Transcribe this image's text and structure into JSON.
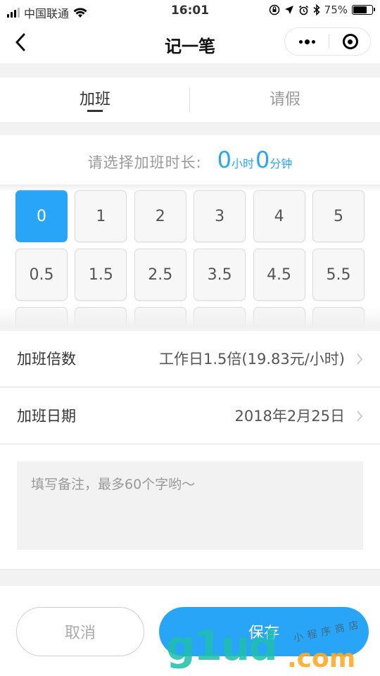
{
  "status_bar": {
    "carrier": "中国联通",
    "time": "16:01",
    "battery_percent": "75%",
    "battery_level": 0.75
  },
  "nav": {
    "title": "记一笔",
    "back_icon": "chevron-left-icon",
    "more_icon": "more-dots-icon",
    "close_icon": "target-circle-icon"
  },
  "tabs": [
    {
      "label": "加班",
      "active": true
    },
    {
      "label": "请假",
      "active": false
    }
  ],
  "duration": {
    "prompt": "请选择加班时长:",
    "hours": "0",
    "hours_unit": "小时",
    "minutes": "0",
    "minutes_unit": "分钟"
  },
  "picker": {
    "options": [
      "0",
      "1",
      "2",
      "3",
      "4",
      "5",
      "0.5",
      "1.5",
      "2.5",
      "3.5",
      "4.5",
      "5.5",
      "",
      "",
      "",
      "",
      "",
      ""
    ],
    "selected": "0"
  },
  "rate_row": {
    "label": "加班倍数",
    "value": "工作日1.5倍(19.83元/小时)"
  },
  "date_row": {
    "label": "加班日期",
    "value": "2018年2月25日"
  },
  "note": {
    "placeholder": "填写备注，最多60个字哟～",
    "value": ""
  },
  "buttons": {
    "cancel": "取消",
    "save": "保存"
  },
  "watermark": {
    "logo": "g1ud",
    "dot_com": ".com",
    "tagline": "小程序商店"
  },
  "colors": {
    "accent": "#29a5f7",
    "watermark_green": "#1ebeaa",
    "watermark_orange": "#ffaa28"
  }
}
